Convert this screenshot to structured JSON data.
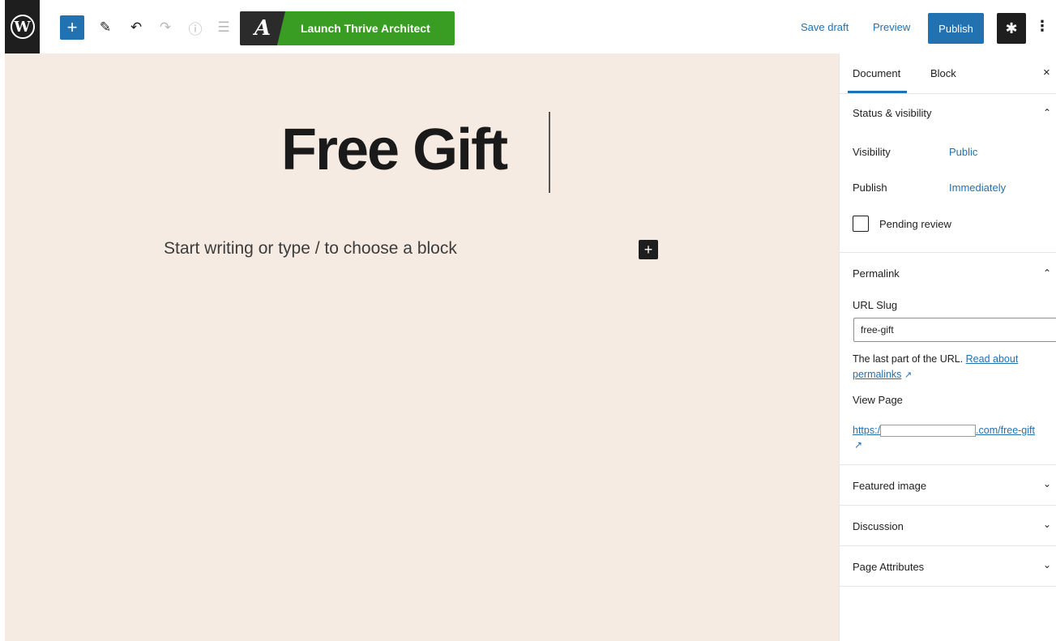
{
  "toolbar": {
    "wp_logo": "W",
    "add_block_icon": "+",
    "tools_icon": "pencil-icon",
    "undo_icon": "undo-icon",
    "redo_icon": "redo-icon",
    "details_icon": "info-icon",
    "outline_icon": "list-view-icon",
    "thrive_logo": "A",
    "thrive_label": "Launch Thrive Architect",
    "save_draft": "Save draft",
    "preview": "Preview",
    "publish": "Publish",
    "settings_icon": "gear-icon",
    "more_icon": "⋮"
  },
  "editor": {
    "title": "Free Gift",
    "placeholder": "Start writing or type / to choose a block",
    "inline_add": "+"
  },
  "sidebar": {
    "tabs": {
      "document": "Document",
      "block": "Block"
    },
    "close": "×",
    "status": {
      "title": "Status & visibility",
      "visibility_label": "Visibility",
      "visibility_value": "Public",
      "publish_label": "Publish",
      "publish_value": "Immediately",
      "pending_label": "Pending review",
      "pending_checked": false
    },
    "permalink": {
      "title": "Permalink",
      "slug_label": "URL Slug",
      "slug_value": "free-gift",
      "help_prefix": "The last part of the URL. ",
      "help_link_1": "Read about",
      "help_link_2": "permalinks",
      "view_page_label": "View Page",
      "url_prefix": "https:/",
      "url_suffix": ".com/free-gift"
    },
    "featured_image": "Featured image",
    "discussion": "Discussion",
    "page_attributes": "Page Attributes"
  },
  "colors": {
    "accent": "#2271b1",
    "thrive_green": "#3a9d23",
    "canvas_bg": "#f5ebe2",
    "dark": "#1e1e1e"
  }
}
